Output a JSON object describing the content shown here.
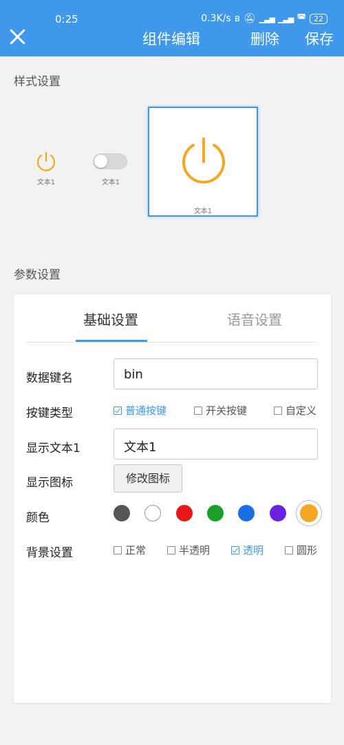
{
  "status_bar": {
    "time": "0:25",
    "speed": "0.3K/s",
    "battery": "22"
  },
  "header": {
    "title": "组件编辑",
    "delete_label": "删除",
    "save_label": "保存"
  },
  "style_section": {
    "label": "样式设置"
  },
  "previews": [
    {
      "kind": "power",
      "label": "文本1"
    },
    {
      "kind": "switch",
      "label": "文本1"
    },
    {
      "kind": "power-large",
      "label": "文本1"
    }
  ],
  "param_section": {
    "label": "参数设置"
  },
  "tabs": [
    {
      "label": "基础设置",
      "active": true
    },
    {
      "label": "语音设置",
      "active": false
    }
  ],
  "form": {
    "data_key": {
      "label": "数据键名",
      "value": "bin"
    },
    "key_type": {
      "label": "按键类型",
      "options": [
        {
          "label": "普通按键",
          "checked": true
        },
        {
          "label": "开关按键",
          "checked": false
        },
        {
          "label": "自定义",
          "checked": false
        }
      ]
    },
    "display_text": {
      "label": "显示文本1",
      "value": "文本1"
    },
    "display_icon": {
      "label": "显示图标",
      "button": "修改图标"
    },
    "color": {
      "label": "颜色",
      "swatches": [
        "#555555",
        "#ffffff",
        "#e81818",
        "#1a9e2a",
        "#1a6fe8",
        "#6a22e0",
        "#f5a623"
      ],
      "selected": "#f5a623"
    },
    "background": {
      "label": "背景设置",
      "options": [
        {
          "label": "正常",
          "checked": false
        },
        {
          "label": "半透明",
          "checked": false
        },
        {
          "label": "透明",
          "checked": true
        },
        {
          "label": "圆形",
          "checked": false
        }
      ]
    }
  },
  "accent_color": "#3f98ea",
  "icon_color": "#f5a623"
}
